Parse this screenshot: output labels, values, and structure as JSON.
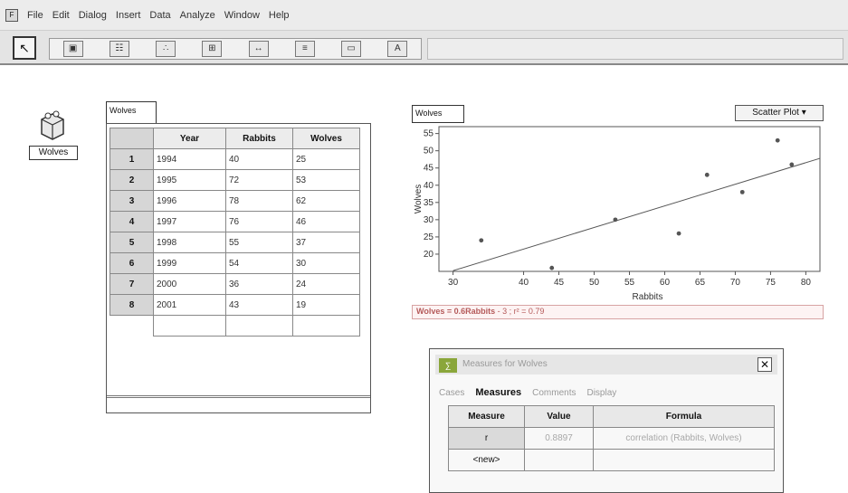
{
  "app": {
    "menu": [
      "File",
      "Edit",
      "Dialog",
      "Insert",
      "Data",
      "Analyze",
      "Window",
      "Help"
    ]
  },
  "toolbar": {
    "tools": [
      "collection-tool",
      "case-table-tool",
      "graph-tool",
      "summary-table-tool",
      "slider-tool",
      "calculator-tool",
      "text-tool",
      "function-tool"
    ]
  },
  "collection": {
    "label": "Wolves"
  },
  "case_table": {
    "tab": "Wolves",
    "columns": [
      "Year",
      "Rabbits",
      "Wolves"
    ],
    "rows": [
      {
        "index": "1",
        "year": "1994",
        "rabbits": "40",
        "wolves": "25"
      },
      {
        "index": "2",
        "year": "1995",
        "rabbits": "72",
        "wolves": "53"
      },
      {
        "index": "3",
        "year": "1996",
        "rabbits": "78",
        "wolves": "62"
      },
      {
        "index": "4",
        "year": "1997",
        "rabbits": "76",
        "wolves": "46"
      },
      {
        "index": "5",
        "year": "1998",
        "rabbits": "55",
        "wolves": "37"
      },
      {
        "index": "6",
        "year": "1999",
        "rabbits": "54",
        "wolves": "30"
      },
      {
        "index": "7",
        "year": "2000",
        "rabbits": "36",
        "wolves": "24"
      },
      {
        "index": "8",
        "year": "2001",
        "rabbits": "43",
        "wolves": "19"
      }
    ]
  },
  "graph": {
    "tab": "Wolves",
    "type_menu": "Scatter Plot ▾",
    "lsrl_title": "Wolves = 0.6Rabbits",
    "lsrl_formula": "- 3 ; r² = 0.79"
  },
  "chart_data": {
    "type": "scatter",
    "xlabel": "Rabbits",
    "ylabel": "Wolves",
    "xlim": [
      28,
      82
    ],
    "ylim": [
      15,
      57
    ],
    "xticks": [
      30,
      40,
      45,
      50,
      55,
      60,
      65,
      70,
      75,
      80
    ],
    "yticks": [
      20,
      25,
      30,
      35,
      40,
      45,
      50,
      55
    ],
    "points": [
      {
        "x": 34,
        "y": 24
      },
      {
        "x": 44,
        "y": 16
      },
      {
        "x": 53,
        "y": 30
      },
      {
        "x": 62,
        "y": 26
      },
      {
        "x": 66,
        "y": 43
      },
      {
        "x": 71,
        "y": 38
      },
      {
        "x": 76,
        "y": 53
      },
      {
        "x": 78,
        "y": 46
      }
    ],
    "line": {
      "x": [
        30,
        82
      ],
      "y": [
        15.2,
        47.8
      ]
    },
    "grid": false,
    "colors": {
      "points": "#555555",
      "line": "#555555"
    }
  },
  "calculator": {
    "title": "Measures for Wolves",
    "tabs": [
      "Cases",
      "Measures",
      "Comments",
      "Display"
    ],
    "active_tab": "Measures",
    "columns": [
      "Measure",
      "Value",
      "Formula"
    ],
    "rows": [
      {
        "measure": "r",
        "value": "0.8897",
        "formula": "correlation (Rabbits, Wolves)"
      },
      {
        "measure": "<new>",
        "value": "",
        "formula": ""
      }
    ]
  },
  "colors": {
    "lsrl": "#b55a5a",
    "calc_icon": "#8aa63a"
  }
}
